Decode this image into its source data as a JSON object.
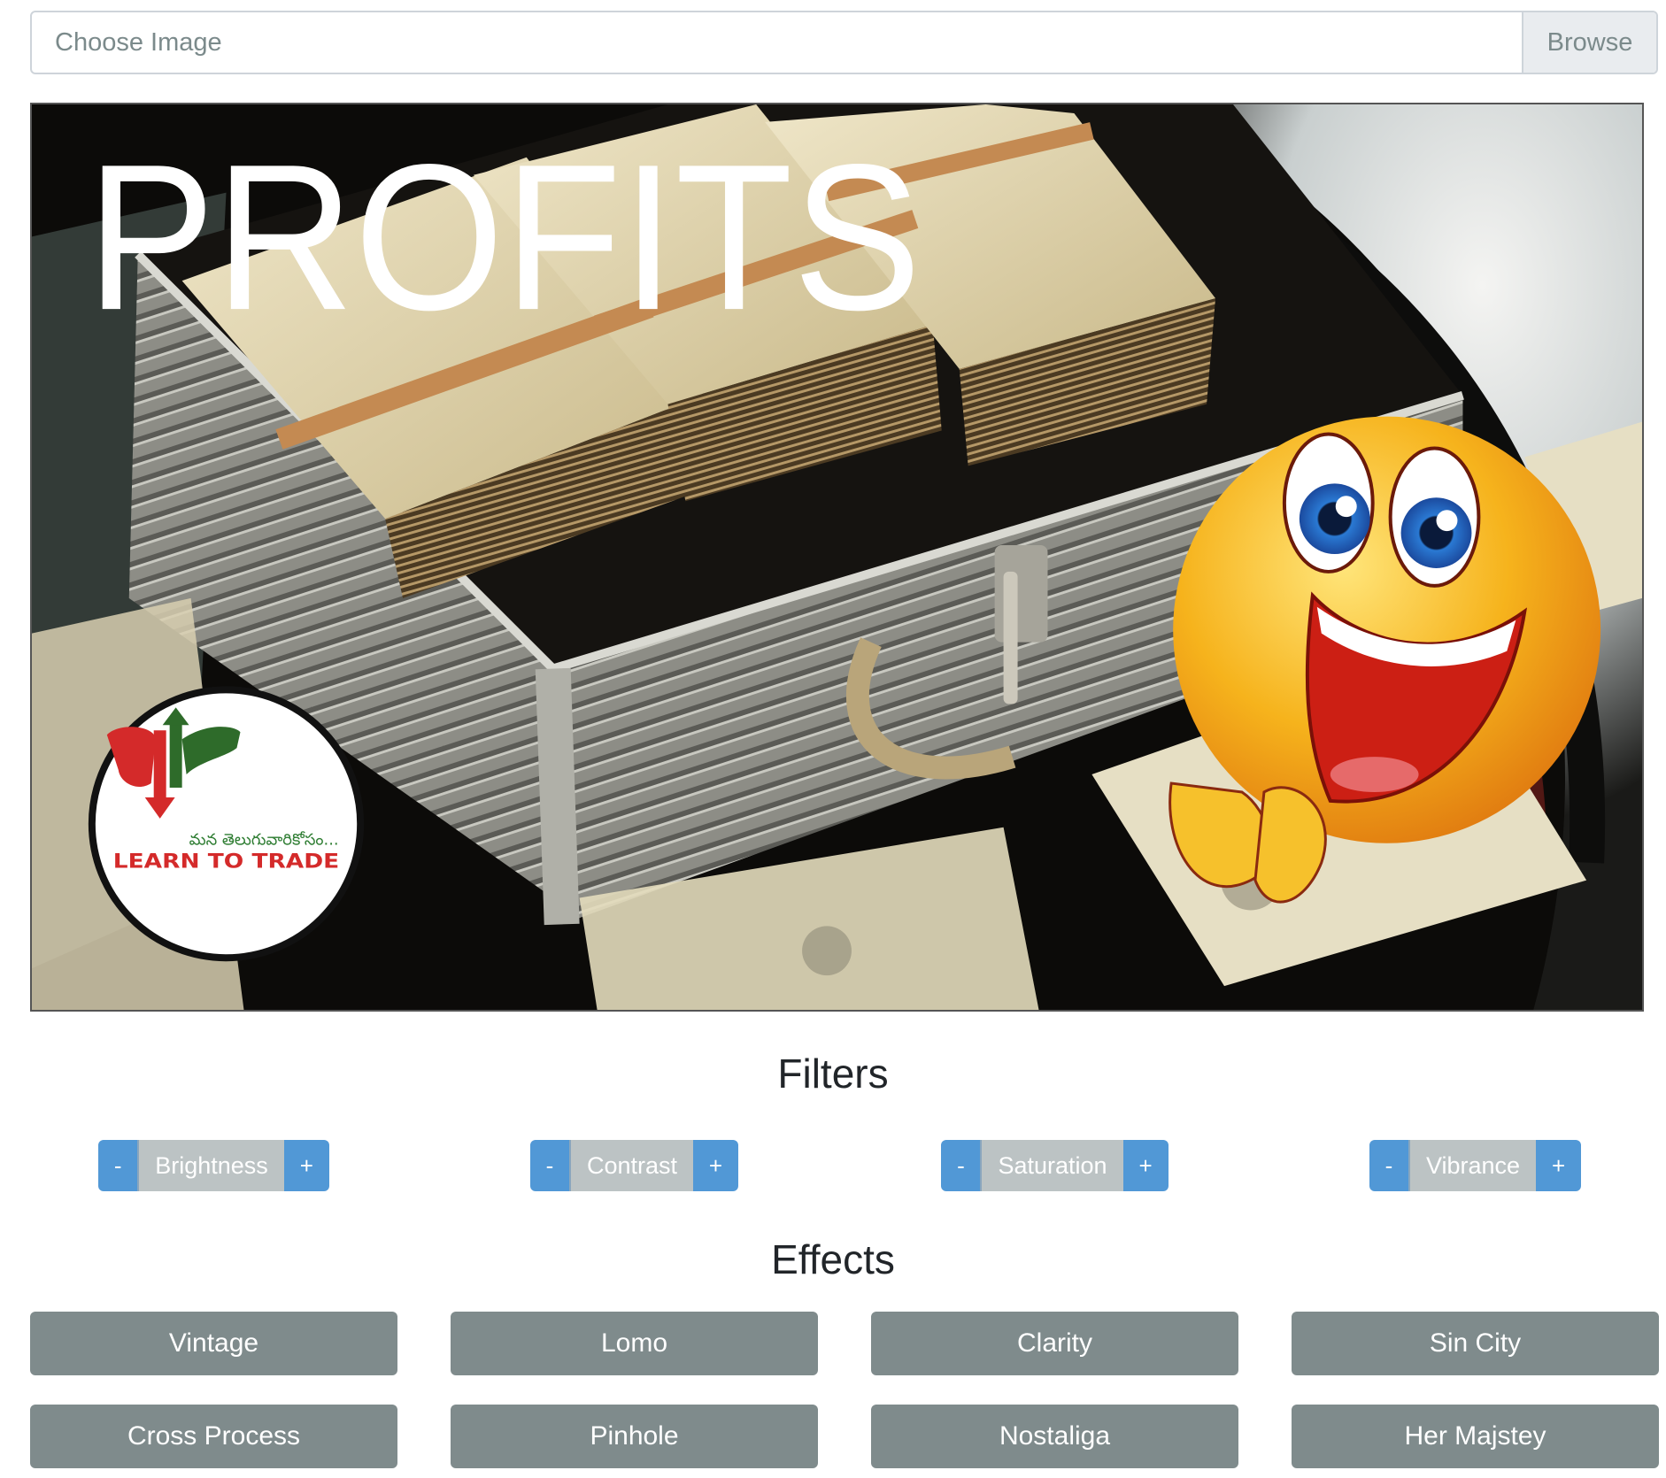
{
  "file_input": {
    "placeholder": "Choose Image",
    "browse_label": "Browse"
  },
  "canvas": {
    "overlay_text": "PROFITS",
    "logo": {
      "telugu_tagline": "మన తెలుగువారికోసం...",
      "title": "LEARN TO TRADE"
    },
    "colors": {
      "logo_red": "#d42a2a",
      "logo_green": "#2e6b2a",
      "emoji_yellow": "#f6b31c"
    }
  },
  "filters": {
    "title": "Filters",
    "minus_label": "-",
    "plus_label": "+",
    "items": [
      {
        "label": "Brightness"
      },
      {
        "label": "Contrast"
      },
      {
        "label": "Saturation"
      },
      {
        "label": "Vibrance"
      }
    ],
    "colors": {
      "step_button": "#5198d6",
      "label_bg": "#bcc3c4"
    }
  },
  "effects": {
    "title": "Effects",
    "items": [
      {
        "label": "Vintage"
      },
      {
        "label": "Lomo"
      },
      {
        "label": "Clarity"
      },
      {
        "label": "Sin City"
      },
      {
        "label": "Cross Process"
      },
      {
        "label": "Pinhole"
      },
      {
        "label": "Nostaliga"
      },
      {
        "label": "Her Majstey"
      }
    ],
    "colors": {
      "button_bg": "#7f8b8c"
    }
  }
}
